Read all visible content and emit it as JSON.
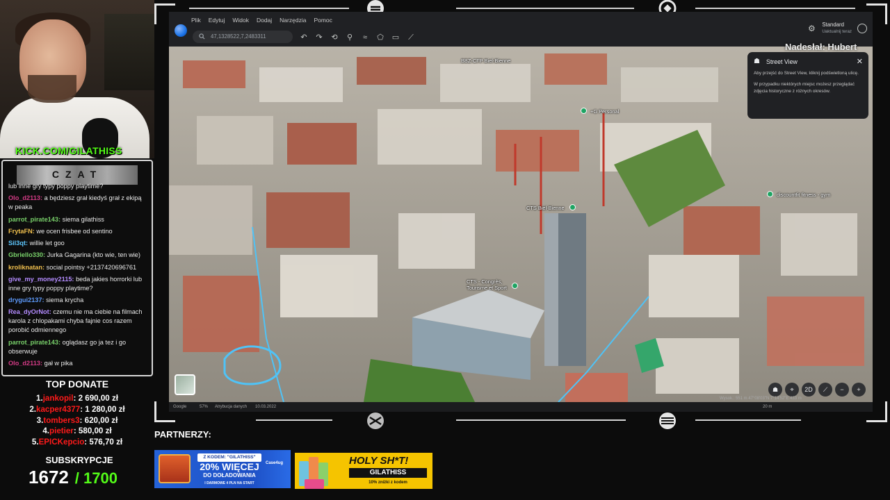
{
  "stream": {
    "kick_url": "KICK.COM/GILATHISS",
    "chat_title": "CZAT",
    "chat_messages": [
      {
        "user": "",
        "text": "lub inne gry typy poppy playtime?",
        "color": "#eaeaea"
      },
      {
        "user": "Olo_d2113:",
        "text": "a będziesz grał kiedyś grał z ekipą w peaka",
        "color": "#d43b86"
      },
      {
        "user": "parrot_pirate143:",
        "text": "siema gilathiss",
        "color": "#7ad36b"
      },
      {
        "user": "FrytaFN:",
        "text": "we ocen frisbee od sentino",
        "color": "#f2c14e"
      },
      {
        "user": "Sil3qt:",
        "text": "willie let goo",
        "color": "#5ec8ff"
      },
      {
        "user": "Gbriello330:",
        "text": "Jurka Gagarina (kto wie, ten wie)",
        "color": "#7ad36b"
      },
      {
        "user": "kroliknatan:",
        "text": "social pointsy +2137420696761",
        "color": "#f2c14e"
      },
      {
        "user": "give_my_money2115:",
        "text": "beda jakies horrorki lub inne gry typy poppy playtime?",
        "color": "#b48cff"
      },
      {
        "user": "drygui2137:",
        "text": "siema krycha",
        "color": "#5e9cff"
      },
      {
        "user": "Rea_dyOrNot:",
        "text": "czemu nie ma ciebie na filmach karola z chlopakami chyba fajnie cos razem porobić odmiennego",
        "color": "#b48cff"
      },
      {
        "user": "parrot_pirate143:",
        "text": "oglądasz go ja tez i go obserwuje",
        "color": "#7ad36b"
      },
      {
        "user": "Olo_d2113:",
        "text": "gał w pika",
        "color": "#d43b86"
      }
    ],
    "top_donate_title": "TOP DONATE",
    "top_donate": [
      {
        "rank": "1.",
        "name": "jankopil",
        "amount": "2 690,00 zł"
      },
      {
        "rank": "2.",
        "name": "kacper4377",
        "amount": "1 280,00 zł"
      },
      {
        "rank": "3.",
        "name": "tombers3",
        "amount": "620,00 zł"
      },
      {
        "rank": "4.",
        "name": "pietier",
        "amount": "580,00 zł"
      },
      {
        "rank": "5.",
        "name": "EPICKepcio",
        "amount": "576,70 zł"
      }
    ],
    "subs_title": "SUBSKRYPCJE",
    "subs_current": "1672",
    "subs_goal": "/ 1700",
    "subs_progress": 0.9835,
    "partners_label": "PARTNERZY:",
    "nadeslal": "Nadesłał: Hubert",
    "banner1": {
      "code": "Z KODEM: \"GILATHISS\"",
      "big": "20% WIĘCEJ",
      "mid": "DO DOŁADOWANIA",
      "small": "I DARMOWE 4 PLN NA START",
      "logo": "Case4ug"
    },
    "banner2": {
      "headline": "HOLY SH*T!",
      "code": "GILATHISS",
      "small": "10% zniżki z kodem"
    }
  },
  "earth": {
    "menus": [
      "Plik",
      "Edytuj",
      "Widok",
      "Dodaj",
      "Narzędzia",
      "Pomoc"
    ],
    "search_value": "47,1328522,7,2483311",
    "account_label": "Standard",
    "account_sub": "Uaktualnij teraz",
    "street_view": {
      "title": "Street View",
      "text1": "Aby przejść do Street View, kliknij podświetloną ulicę.",
      "text2": "W przypadku niektórych miejsc możesz przeglądać zdjęcia historyczne z różnych okresów."
    },
    "places": [
      {
        "label": "BBZ-CFP Biel-Bienne"
      },
      {
        "label": "+G Personal"
      },
      {
        "label": "discountfit fitness - gym"
      },
      {
        "label": "CTS Biel-Bienne"
      },
      {
        "label": "CTS - Congrès, Tourisme et Sport"
      }
    ],
    "status": {
      "google": "Google",
      "pct": "57%",
      "attribution": "Atrybucja danych",
      "date": "10.03.2022",
      "scale": "20 m",
      "coords": "Wysok.: 551 m  47°08'03\"N 7°14'52\"E  433 m"
    },
    "controls": {
      "mode": "2D"
    }
  }
}
